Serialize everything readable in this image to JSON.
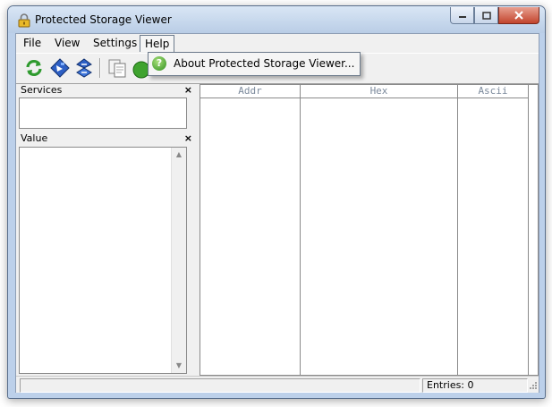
{
  "window": {
    "title": "Protected Storage Viewer"
  },
  "menubar": {
    "items": [
      "File",
      "View",
      "Settings",
      "Help"
    ]
  },
  "help_menu": {
    "items": [
      {
        "label": "About Protected Storage Viewer..."
      }
    ]
  },
  "toolbar": {
    "buttons": [
      "refresh-icon",
      "unlock-icon",
      "swap-icon",
      "copy-icon"
    ]
  },
  "panes": {
    "services": {
      "title": "Services"
    },
    "value": {
      "title": "Value"
    }
  },
  "grid": {
    "columns": [
      "Addr",
      "Hex",
      "Ascii"
    ]
  },
  "status": {
    "entries": "Entries: 0"
  },
  "colors": {
    "titlebar": "#c7d8ef",
    "close_button": "#c2442d",
    "column_header_text": "#7c8a9c"
  }
}
